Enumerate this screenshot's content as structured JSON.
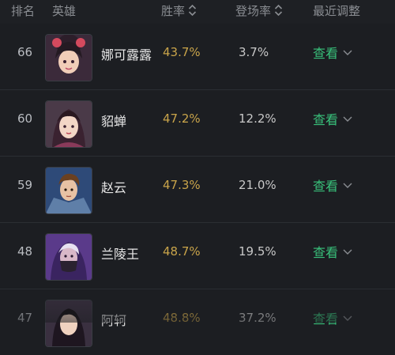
{
  "header": {
    "rank": "排名",
    "hero": "英雄",
    "win_rate": "胜率",
    "pick_rate": "登场率",
    "recent_adjust": "最近调整"
  },
  "colors": {
    "accent_green": "#38c07a",
    "win_rate_gold": "#c9a44a",
    "background": "#1c1e22"
  },
  "rows": [
    {
      "rank": "66",
      "name": "娜可露露",
      "win_rate": "43.7%",
      "pick_rate": "3.7%",
      "action": "查看"
    },
    {
      "rank": "60",
      "name": "貂蝉",
      "win_rate": "47.2%",
      "pick_rate": "12.2%",
      "action": "查看"
    },
    {
      "rank": "59",
      "name": "赵云",
      "win_rate": "47.3%",
      "pick_rate": "21.0%",
      "action": "查看"
    },
    {
      "rank": "48",
      "name": "兰陵王",
      "win_rate": "48.7%",
      "pick_rate": "19.5%",
      "action": "查看"
    },
    {
      "rank": "47",
      "name": "阿轲",
      "win_rate": "48.8%",
      "pick_rate": "37.2%",
      "action": "查看"
    }
  ]
}
